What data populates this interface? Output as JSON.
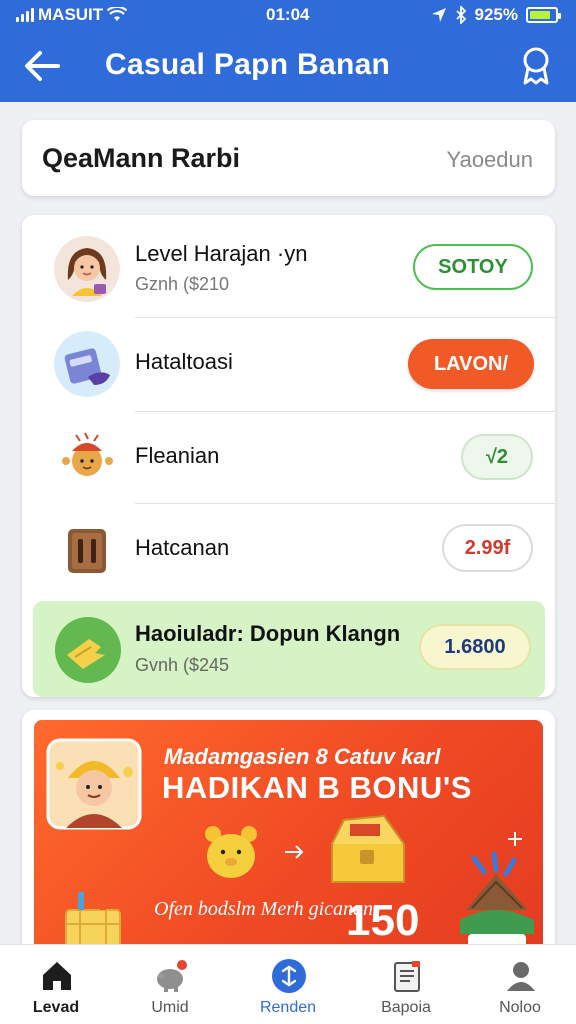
{
  "status_bar": {
    "carrier": "MASUIT",
    "time": "01:04",
    "battery_text": "925%",
    "battery_level": 0.85
  },
  "header": {
    "title": "Casual Papn Banan",
    "back_icon": "arrow-left-icon",
    "action_icon": "award-icon"
  },
  "search": {
    "title": "QeaMann Rarbi",
    "hint": "Yaoedun"
  },
  "rewards": [
    {
      "label": "Level Harajan ·yn",
      "sub": "Gznh ($210",
      "action": "SOTOY",
      "icon": "girl-avatar-icon",
      "style": "outline-green"
    },
    {
      "label": "Hataltoasi",
      "sub": "",
      "action": "LAVON/",
      "icon": "ticket-icon",
      "style": "filled-orange"
    },
    {
      "label": "Fleanian",
      "sub": "",
      "action": "√2",
      "icon": "character-icon",
      "style": "soft-green"
    },
    {
      "label": "Hatcanan",
      "sub": "",
      "action": "2.99f",
      "icon": "chest-icon",
      "style": "outline-gray"
    },
    {
      "label": "Haoiuladr: Dopun Klangn",
      "sub": "Gvnh ($245",
      "action": "1.6800",
      "icon": "ticket-green-icon",
      "style": "soft-yellow"
    }
  ],
  "promo": {
    "line1": "Madamgasien 8 Catuv karl",
    "line2": "HADIKAN B BONU'S",
    "italic": "Ofen bodslm Merh gicanan.",
    "amount": "150",
    "bg_color": "#f04a24"
  },
  "nav": [
    {
      "label": "Levad",
      "icon": "home-icon",
      "active": false
    },
    {
      "label": "Umid",
      "icon": "piggy-bank-icon",
      "active": false
    },
    {
      "label": "Renden",
      "icon": "rewards-icon",
      "active": true
    },
    {
      "label": "Bapoia",
      "icon": "clipboard-icon",
      "active": false
    },
    {
      "label": "Noloo",
      "icon": "profile-icon",
      "active": false
    }
  ]
}
